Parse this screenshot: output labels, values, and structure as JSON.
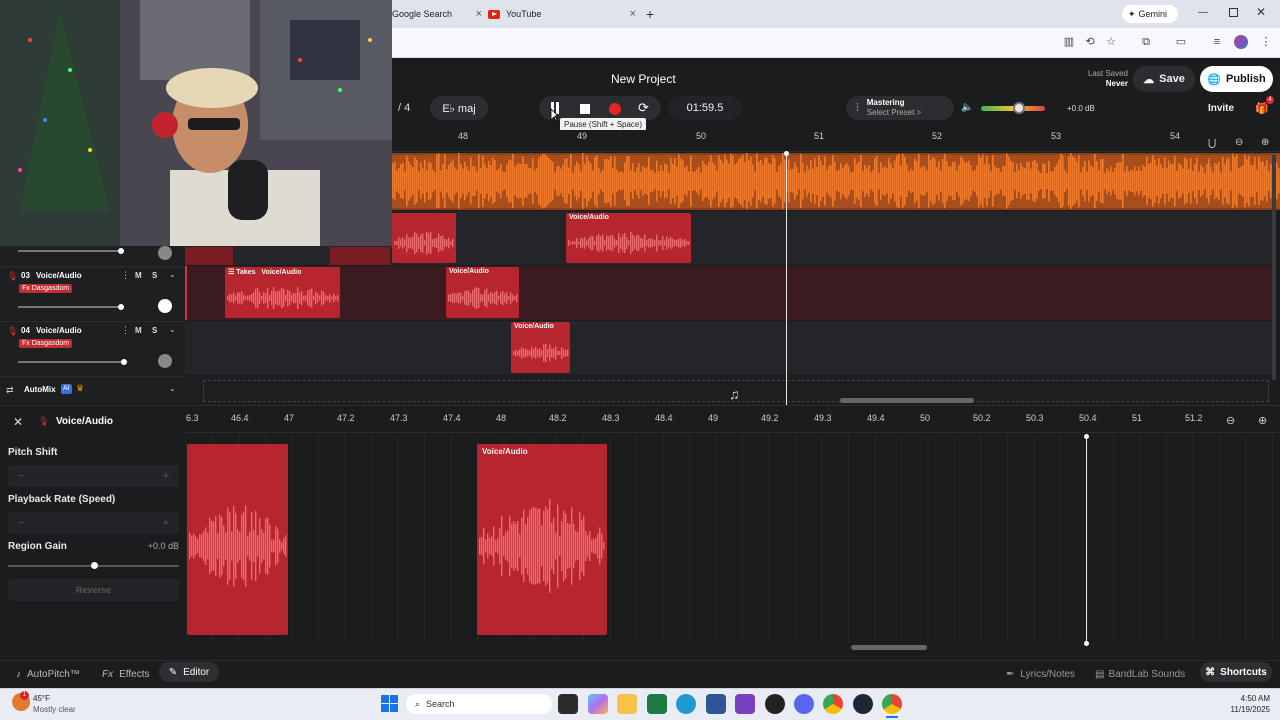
{
  "browser": {
    "tabs": [
      {
        "label": "Google Search"
      },
      {
        "label": "YouTube"
      }
    ],
    "gemini_label": "Gemini",
    "new_tab_symbol": "+",
    "close_symbol": "×"
  },
  "header": {
    "project_title": "New Project",
    "last_saved_label": "Last Saved",
    "last_saved_value": "Never",
    "save_label": "Save",
    "publish_label": "Publish",
    "time_signature_fragment": "/ 4",
    "key_label": "E♭ maj",
    "time": "01:59.5",
    "pause_tooltip": "Pause (Shift + Space)",
    "mastering_label": "Mastering",
    "mastering_preset": "Select Preset >",
    "volume_db": "+0.0 dB",
    "invite_label": "Invite",
    "gift_badge": "4",
    "master_volume_level": 0.6
  },
  "top_ruler": {
    "labels": [
      "48",
      "49",
      "50",
      "51",
      "52",
      "53",
      "54"
    ]
  },
  "tracks": [
    {
      "number": "03",
      "name": "Voice/Audio",
      "fx": "Fx Dasgasdom",
      "m": "M",
      "s": "S",
      "volume_level": 0.75
    },
    {
      "number": "04",
      "name": "Voice/Audio",
      "fx": "Fx Dasgasdom",
      "m": "M",
      "s": "S",
      "volume_level": 0.75
    }
  ],
  "clips": {
    "voice_audio": "Voice/Audio",
    "takes": "Takes"
  },
  "automix": {
    "label": "AutoMix",
    "ai_badge": "AI"
  },
  "editor": {
    "title": "Voice/Audio",
    "pitch_shift_label": "Pitch Shift",
    "playback_rate_label": "Playback Rate (Speed)",
    "region_gain_label": "Region Gain",
    "region_gain_value": "+0.0 dB",
    "reverse_label": "Reverse",
    "stepper_minus": "−",
    "stepper_plus": "+",
    "region_gain_level": 0.5,
    "ruler_labels": [
      "6.3",
      "46.4",
      "47",
      "47.2",
      "47.3",
      "47.4",
      "48",
      "48.2",
      "48.3",
      "48.4",
      "49",
      "49.2",
      "49.3",
      "49.4",
      "50",
      "50.2",
      "50.3",
      "50.4",
      "51",
      "51.2"
    ],
    "clip_label": "Voice/Audio"
  },
  "bottom_bar": {
    "autopitch": "AutoPitch™",
    "effects": "Effects",
    "editor": "Editor",
    "lyrics": "Lyrics/Notes",
    "bandlab_sounds": "BandLab Sounds",
    "shortcuts": "Shortcuts",
    "fx_prefix": "Fx"
  },
  "taskbar": {
    "weather_temp": "45°F",
    "weather_desc": "Mostly clear",
    "weather_badge": "1",
    "search_label": "Search",
    "time": "4:50 AM",
    "date": "11/19/2025"
  },
  "colors": {
    "accent_red": "#b7262e",
    "waveform_orange": "#f07a2c",
    "record_red": "#e5252b"
  }
}
